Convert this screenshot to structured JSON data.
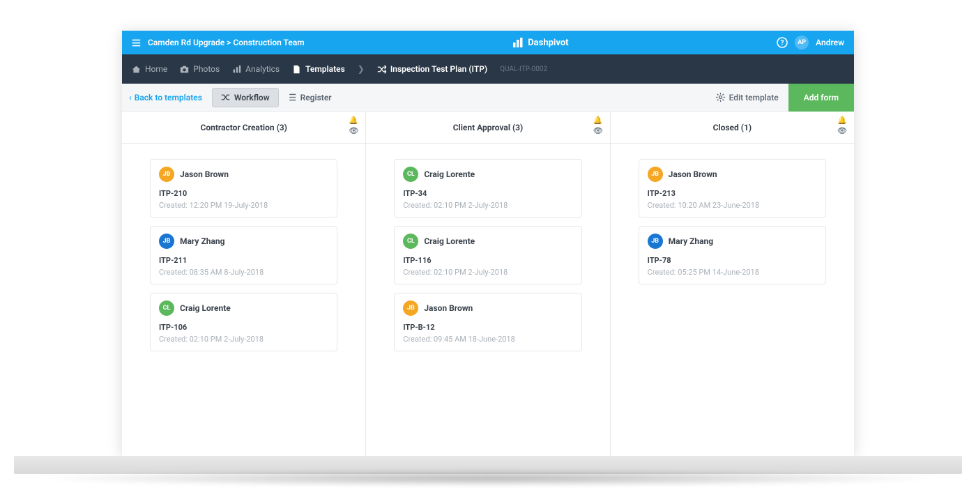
{
  "topbar": {
    "breadcrumb": "Camden Rd Upgrade > Construction Team",
    "brand": "Dashpivot",
    "user_initials": "AP",
    "user_name": "Andrew"
  },
  "nav": {
    "home": "Home",
    "photos": "Photos",
    "analytics": "Analytics",
    "templates": "Templates",
    "breadcrumb_item": "Inspection Test Plan (ITP)",
    "template_id": "QUAL-ITP-0002"
  },
  "toolbar": {
    "back_label": "Back to templates",
    "workflow_label": "Workflow",
    "register_label": "Register",
    "edit_label": "Edit template",
    "add_label": "Add form"
  },
  "columns": [
    {
      "title": "Contractor Creation (3)",
      "cards": [
        {
          "initials": "JB",
          "color": "orange",
          "name": "Jason Brown",
          "code": "ITP-210",
          "created": "Created: 12:20 PM 19-July-2018"
        },
        {
          "initials": "JB",
          "color": "blue",
          "name": "Mary Zhang",
          "code": "ITP-211",
          "created": "Created: 08:35 AM 8-July-2018"
        },
        {
          "initials": "CL",
          "color": "green",
          "name": "Craig Lorente",
          "code": "ITP-106",
          "created": "Created: 02:10 PM 2-July-2018"
        }
      ]
    },
    {
      "title": "Client Approval (3)",
      "cards": [
        {
          "initials": "CL",
          "color": "green",
          "name": "Craig Lorente",
          "code": "ITP-34",
          "created": "Created: 02:10 PM 2-July-2018"
        },
        {
          "initials": "CL",
          "color": "green",
          "name": "Craig Lorente",
          "code": "ITP-116",
          "created": "Created: 02:10 PM 2-July-2018"
        },
        {
          "initials": "JB",
          "color": "orange",
          "name": "Jason Brown",
          "code": "ITP-B-12",
          "created": "Created: 09:45 AM 18-June-2018"
        }
      ]
    },
    {
      "title": "Closed (1)",
      "cards": [
        {
          "initials": "JB",
          "color": "orange",
          "name": "Jason Brown",
          "code": "ITP-213",
          "created": "Created: 10:20 AM 23-June-2018"
        },
        {
          "initials": "JB",
          "color": "blue",
          "name": "Mary Zhang",
          "code": "ITP-78",
          "created": "Created: 05:25 PM 14-June-2018"
        }
      ]
    }
  ]
}
